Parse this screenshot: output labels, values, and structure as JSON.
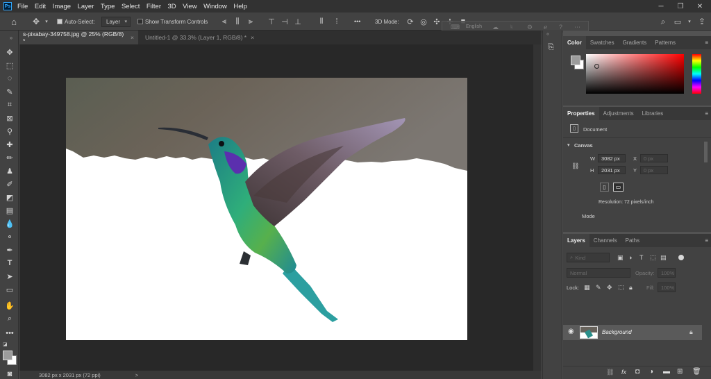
{
  "app": {
    "logo": "Ps"
  },
  "menu": [
    "File",
    "Edit",
    "Image",
    "Layer",
    "Type",
    "Select",
    "Filter",
    "3D",
    "View",
    "Window",
    "Help"
  ],
  "window_controls": {
    "minimize": "─",
    "restore": "❐",
    "close": "✕"
  },
  "options": {
    "auto_select_label": "Auto-Select:",
    "auto_select_value": "Layer",
    "transform_label": "Show Transform Controls",
    "mode_3d_label": "3D Mode:",
    "more": "•••",
    "floating_label": "English"
  },
  "tabs": [
    {
      "label": "s-pixabay-349758.jpg @ 25% (RGB/8) *",
      "close": "×"
    },
    {
      "label": "Untitled-1 @ 33.3% (Layer 1, RGB/8) *",
      "close": "×"
    }
  ],
  "status": {
    "text": "3082 px x 2031 px (72 ppi)",
    "arrow": ">"
  },
  "color_panel": {
    "tabs": [
      "Color",
      "Swatches",
      "Gradients",
      "Patterns"
    ],
    "hue": "#ff0000"
  },
  "properties": {
    "tabs": [
      "Properties",
      "Adjustments",
      "Libraries"
    ],
    "document_label": "Document",
    "canvas_label": "Canvas",
    "w_label": "W",
    "w_value": "3082 px",
    "h_label": "H",
    "h_value": "2031 px",
    "x_label": "X",
    "x_placeholder": "0 px",
    "y_label": "Y",
    "y_placeholder": "0 px",
    "resolution": "Resolution: 72 pixels/inch",
    "mode_label": "Mode"
  },
  "layers": {
    "tabs": [
      "Layers",
      "Channels",
      "Paths"
    ],
    "kind_placeholder": "Kind",
    "blend_mode": "Normal",
    "opacity_label": "Opacity:",
    "opacity_value": "100%",
    "lock_label": "Lock:",
    "fill_label": "Fill:",
    "fill_value": "100%",
    "items": [
      {
        "name": "Background"
      }
    ],
    "footer_icons": [
      "link-icon",
      "fx-icon",
      "mask-icon",
      "adjustment-icon",
      "group-icon",
      "new-layer-icon",
      "trash-icon"
    ]
  },
  "colors": {
    "foreground": "#9c9c9c",
    "background": "#ffffff",
    "accent": "#31a8ff"
  }
}
